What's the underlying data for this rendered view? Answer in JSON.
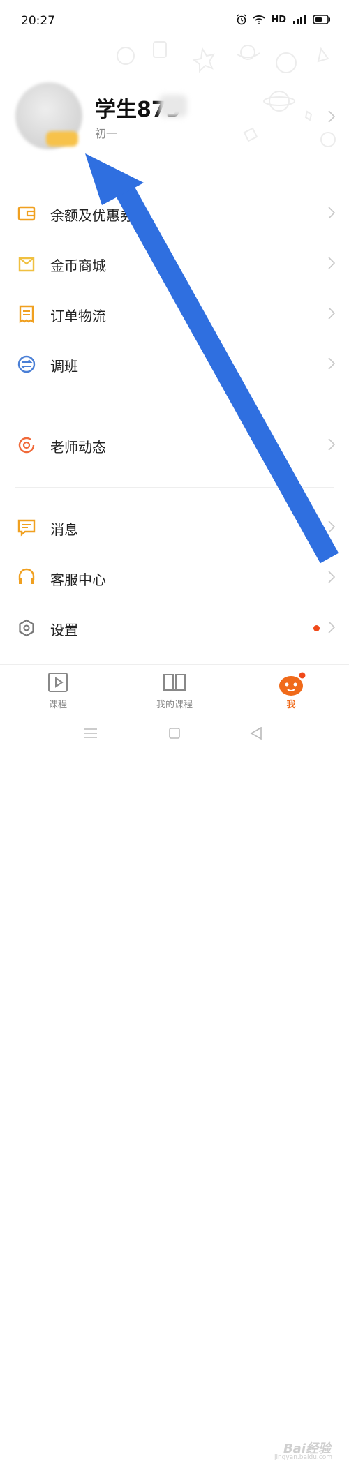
{
  "status_bar": {
    "time": "20:27",
    "hd": "HD"
  },
  "profile": {
    "username": "学生873",
    "grade": "初一"
  },
  "menu": {
    "group1": [
      {
        "label": "余额及优惠券",
        "icon": "wallet-icon"
      },
      {
        "label": "金币商城",
        "icon": "shop-icon"
      },
      {
        "label": "订单物流",
        "icon": "order-icon"
      },
      {
        "label": "调班",
        "icon": "switch-class-icon"
      }
    ],
    "group2": [
      {
        "label": "老师动态",
        "icon": "teacher-feed-icon"
      }
    ],
    "group3": [
      {
        "label": "消息",
        "icon": "message-icon"
      },
      {
        "label": "客服中心",
        "icon": "headset-icon"
      },
      {
        "label": "设置",
        "icon": "settings-icon"
      }
    ]
  },
  "tabs": [
    {
      "label": "课程",
      "icon": "play-icon"
    },
    {
      "label": "我的课程",
      "icon": "book-icon"
    },
    {
      "label": "我",
      "icon": "mascot-icon"
    }
  ],
  "watermark": {
    "text": "Bai经验",
    "sub": "jingyan.baidu.com"
  },
  "colors": {
    "accent": "#f06a1a",
    "icon_orange": "#f0a020",
    "icon_blue": "#4a7fd6",
    "arrow": "#2f6fe0",
    "red_dot": "#f04a1a"
  }
}
